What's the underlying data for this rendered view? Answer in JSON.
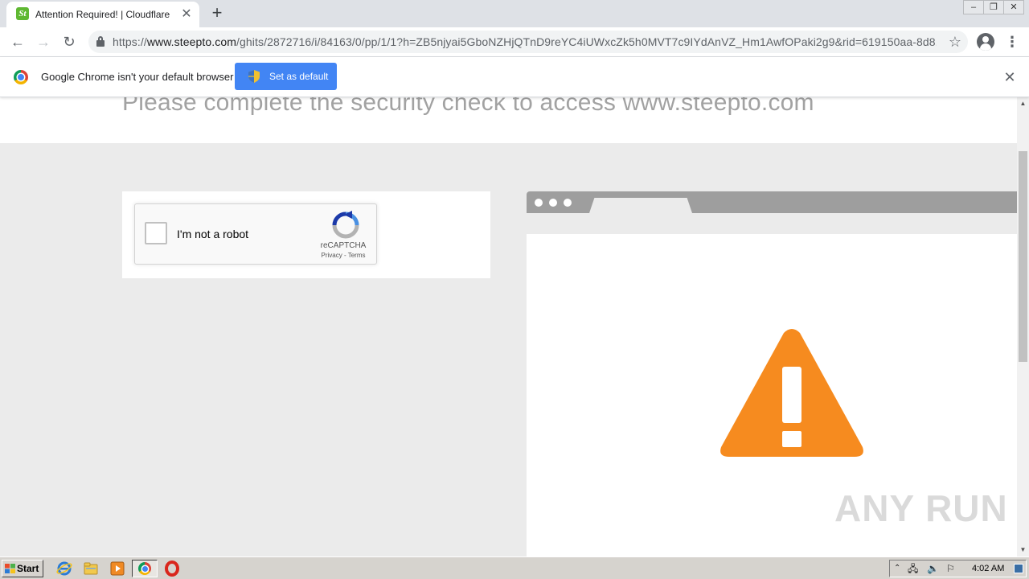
{
  "browser": {
    "tab": {
      "title": "Attention Required! | Cloudflare",
      "favicon_text": "St"
    },
    "window_controls": [
      "minimize",
      "restore",
      "close"
    ],
    "url": {
      "scheme": "https://",
      "host": "www.steepto.com",
      "path": "/ghits/2872716/i/84163/0/pp/1/1?h=ZB5njyai5GboNZHjQTnD9reYC4iUWxcZk5h0MVT7c9IYdAnVZ_Hm1AwfOPaki2g9&rid=619150aa-8d8..."
    },
    "infobar": {
      "message": "Google Chrome isn't your default browser",
      "button_label": "Set as default"
    }
  },
  "page": {
    "headline": "Please complete the security check to access www.steepto.com",
    "recaptcha": {
      "label": "I'm not a robot",
      "brand": "reCAPTCHA",
      "links": "Privacy - Terms",
      "checked": false
    },
    "warning_icon": "warning-triangle",
    "accent_color": "#f68b1f"
  },
  "watermark": "ANY RUN",
  "taskbar": {
    "start_label": "Start",
    "pinned": [
      "internet-explorer",
      "file-explorer",
      "media-player",
      "chrome",
      "opera"
    ],
    "active": "chrome",
    "clock": "4:02 AM"
  }
}
